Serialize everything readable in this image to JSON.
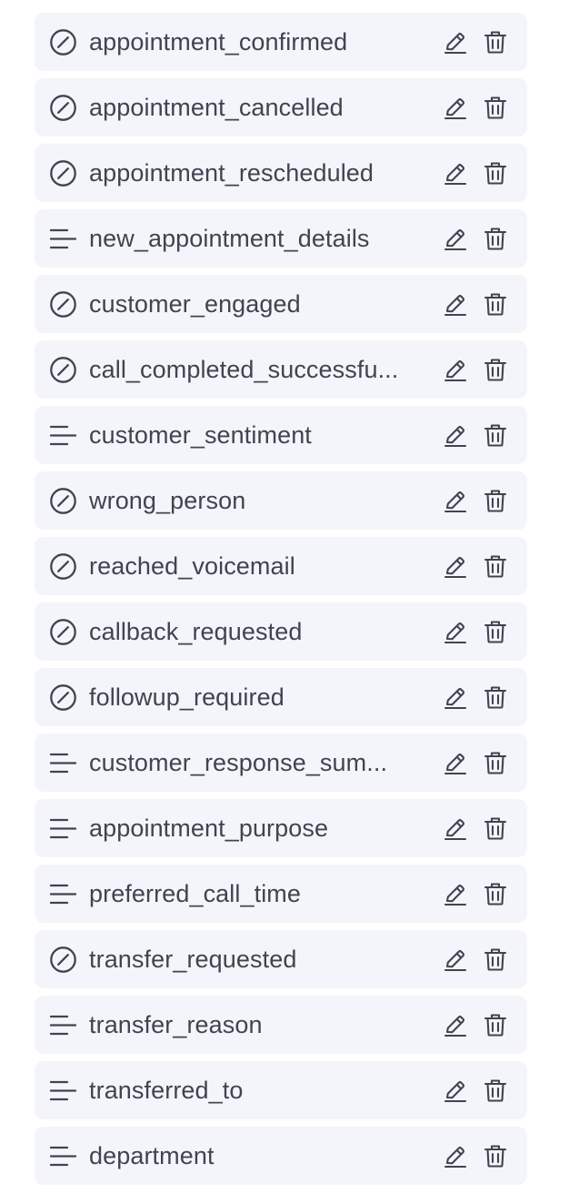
{
  "fields": [
    {
      "name": "appointment_confirmed",
      "type": "boolean",
      "icon": "boolean-icon"
    },
    {
      "name": "appointment_cancelled",
      "type": "boolean",
      "icon": "boolean-icon"
    },
    {
      "name": "appointment_rescheduled",
      "type": "boolean",
      "icon": "boolean-icon"
    },
    {
      "name": "new_appointment_details",
      "type": "text",
      "icon": "text-lines-icon"
    },
    {
      "name": "customer_engaged",
      "type": "boolean",
      "icon": "boolean-icon"
    },
    {
      "name": "call_completed_successfu...",
      "type": "boolean",
      "icon": "boolean-icon"
    },
    {
      "name": "customer_sentiment",
      "type": "text",
      "icon": "text-lines-icon"
    },
    {
      "name": "wrong_person",
      "type": "boolean",
      "icon": "boolean-icon"
    },
    {
      "name": "reached_voicemail",
      "type": "boolean",
      "icon": "boolean-icon"
    },
    {
      "name": "callback_requested",
      "type": "boolean",
      "icon": "boolean-icon"
    },
    {
      "name": "followup_required",
      "type": "boolean",
      "icon": "boolean-icon"
    },
    {
      "name": "customer_response_sum...",
      "type": "text",
      "icon": "text-lines-icon"
    },
    {
      "name": "appointment_purpose",
      "type": "text",
      "icon": "text-lines-icon"
    },
    {
      "name": "preferred_call_time",
      "type": "text",
      "icon": "text-lines-icon"
    },
    {
      "name": "transfer_requested",
      "type": "boolean",
      "icon": "boolean-icon"
    },
    {
      "name": "transfer_reason",
      "type": "text",
      "icon": "text-lines-icon"
    },
    {
      "name": "transferred_to",
      "type": "text",
      "icon": "text-lines-icon"
    },
    {
      "name": "department",
      "type": "text",
      "icon": "text-lines-icon"
    }
  ],
  "actions": {
    "edit_icon": "pencil-edit-icon",
    "delete_icon": "trash-icon"
  },
  "colors": {
    "row_background": "#f4f5fa",
    "text": "#3f4450",
    "icon": "#3f4450"
  }
}
